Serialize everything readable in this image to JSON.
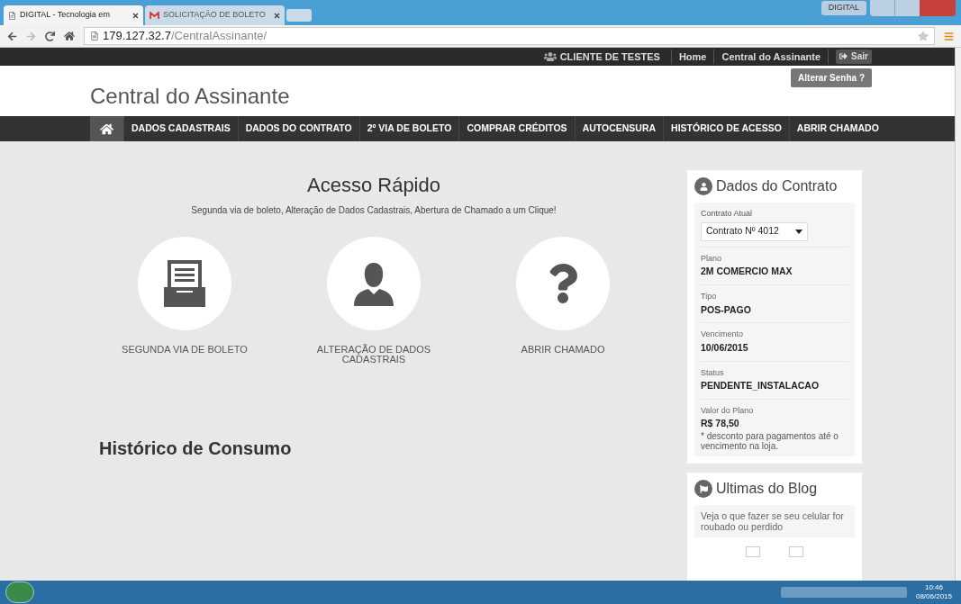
{
  "browser": {
    "tabs": [
      {
        "title": "DIGITAL - Tecnologia em",
        "selected": true,
        "kind": "page"
      },
      {
        "title": "SOLICITAÇÃO DE BOLETO",
        "selected": false,
        "kind": "mail"
      }
    ],
    "window_badge": "DIGITAL",
    "address": {
      "host": "179.127.32.7",
      "path": "/CentralAssinante/"
    }
  },
  "topbar": {
    "user": "CLIENTE DE TESTES",
    "links": [
      "Home",
      "Central do Assinante"
    ],
    "logout": "Sair",
    "tooltip": "Alterar Senha ?"
  },
  "header": {
    "title": "Central do Assinante"
  },
  "nav": [
    {
      "kind": "home",
      "selected": true
    },
    {
      "kind": "link",
      "label": "DADOS CADASTRAIS",
      "selected": false
    },
    {
      "kind": "link",
      "label": "DADOS DO CONTRATO",
      "selected": false
    },
    {
      "kind": "link",
      "label": "2º VIA DE BOLETO",
      "selected": false
    },
    {
      "kind": "link",
      "label": "COMPRAR CRÉDITOS",
      "selected": false
    },
    {
      "kind": "link",
      "label": "AUTOCENSURA",
      "selected": false
    },
    {
      "kind": "link",
      "label": "HISTÓRICO DE ACESSO",
      "selected": false
    },
    {
      "kind": "link",
      "label": "ABRIR CHAMADO",
      "selected": false
    }
  ],
  "quick_access": {
    "title": "Acesso Rápido",
    "subtitle": "Segunda via de boleto, Alteração de Dados Cadastrais, Abertura de Chamado a um Clique!",
    "items": [
      {
        "kind": "boleto",
        "label": "SEGUNDA VIA DE BOLETO"
      },
      {
        "kind": "user",
        "label": "ALTERAÇÃO DE DADOS CADASTRAIS"
      },
      {
        "kind": "help",
        "label": "ABRIR CHAMADO"
      }
    ]
  },
  "consumo": {
    "title": "Histórico de Consumo"
  },
  "contract": {
    "title": "Dados do Contrato",
    "select_label": "Contrato Atual",
    "select_value": "Contrato Nº 4012",
    "fields": [
      {
        "label": "Plano",
        "value": "2M COMERCIO MAX"
      },
      {
        "label": "Tipo",
        "value": "POS-PAGO"
      },
      {
        "label": "Vencimento",
        "value": "10/06/2015"
      },
      {
        "label": "Status",
        "value": "PENDENTE_INSTALACAO"
      },
      {
        "label": "Valor do Plano",
        "value": "R$ 78,50",
        "note": "* desconto para pagamentos até o vencimento na loja."
      }
    ]
  },
  "blog": {
    "title": "Ultimas do Blog",
    "posts": [
      "Veja o que fazer se seu celular for roubado ou perdido"
    ]
  },
  "taskbar": {
    "time": "10:46",
    "date": "08/06/2015"
  }
}
